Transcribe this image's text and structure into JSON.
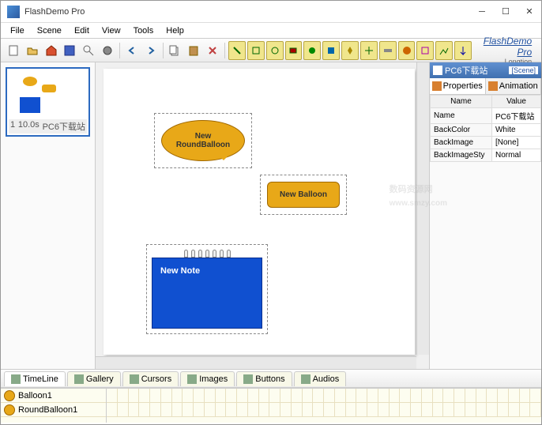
{
  "window": {
    "title": "FlashDemo Pro"
  },
  "menu": [
    "File",
    "Scene",
    "Edit",
    "View",
    "Tools",
    "Help"
  ],
  "brand": {
    "main": "FlashDemo Pro",
    "sub": "Longtion"
  },
  "thumb": {
    "num": "1",
    "time": "10.0s",
    "name": "PC6下载站"
  },
  "objects": {
    "roundballoon": "New RoundBalloon",
    "balloon": "New Balloon",
    "note": "New Note"
  },
  "rpanel": {
    "scene_name": "PC6下载站",
    "scene_tag": "[Scene]",
    "tabs": {
      "props": "Properties",
      "anim": "Animation"
    },
    "cols": {
      "name": "Name",
      "value": "Value"
    },
    "rows": [
      {
        "k": "Name",
        "v": "PC6下载站"
      },
      {
        "k": "BackColor",
        "v": "White"
      },
      {
        "k": "BackImage",
        "v": "[None]"
      },
      {
        "k": "BackImageSty",
        "v": "Normal"
      }
    ]
  },
  "btabs": [
    "TimeLine",
    "Gallery",
    "Cursors",
    "Images",
    "Buttons",
    "Audios"
  ],
  "timeline": [
    "Balloon1",
    "RoundBalloon1"
  ],
  "watermark": {
    "main": "数码资源网",
    "sub": "www.smzy.com"
  }
}
